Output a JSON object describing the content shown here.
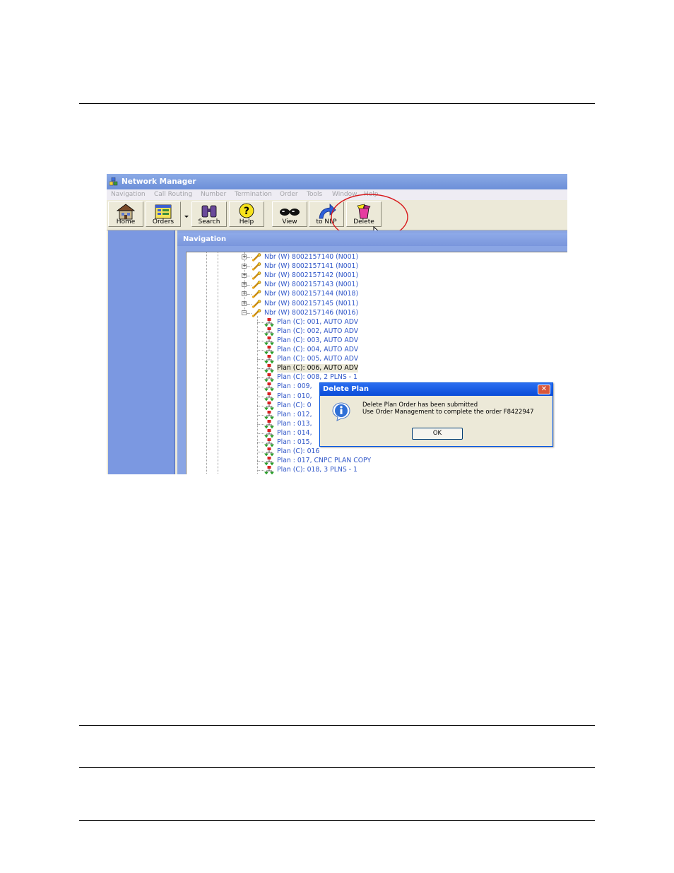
{
  "window": {
    "title": "Network Manager"
  },
  "menubar": {
    "items": [
      "Navigation",
      "Call Routing",
      "Number",
      "Termination",
      "Order",
      "Tools",
      "Window",
      "Help"
    ]
  },
  "toolbar": {
    "buttons": [
      {
        "label": "Home",
        "icon": "house-icon"
      },
      {
        "label": "Orders",
        "icon": "orders-icon"
      },
      {
        "label": "Search",
        "icon": "binoculars-icon"
      },
      {
        "label": "Help",
        "icon": "help-question-icon"
      },
      {
        "label": "View",
        "icon": "glasses-icon"
      },
      {
        "label": "to NLP",
        "icon": "arrow-icon"
      },
      {
        "label": "Delete",
        "icon": "trash-basket-icon"
      }
    ]
  },
  "navigation": {
    "title": "Navigation"
  },
  "tree": {
    "numbers": [
      "Nbr (W) 8002157140 (N001)",
      "Nbr (W) 8002157141 (N001)",
      "Nbr (W) 8002157142 (N001)",
      "Nbr (W) 8002157143 (N001)",
      "Nbr (W) 8002157144 (N018)",
      "Nbr (W) 8002157145 (N011)",
      "Nbr (W) 8002157146 (N016)"
    ],
    "plans": [
      "Plan (C): 001, AUTO ADV",
      "Plan (C): 002, AUTO ADV",
      "Plan (C): 003, AUTO ADV",
      "Plan (C): 004, AUTO ADV",
      "Plan (C): 005, AUTO ADV",
      "Plan (C): 006, AUTO ADV",
      "Plan (C): 008, 2 PLNS - 1",
      "Plan : 009,",
      "Plan : 010,",
      "Plan (C): 0",
      "Plan : 012,",
      "Plan : 013,",
      "Plan : 014,",
      "Plan : 015,",
      "Plan (C): 016",
      "Plan : 017, CNPC PLAN COPY",
      "Plan (C): 018, 3 PLNS - 1"
    ],
    "selected_plan": "Plan (C): 006, AUTO ADV"
  },
  "dialog": {
    "title": "Delete Plan",
    "line1": "Delete Plan Order has been submitted",
    "line2": "Use Order Management to complete the order F8422947",
    "ok_label": "OK",
    "close_glyph": "✕"
  }
}
